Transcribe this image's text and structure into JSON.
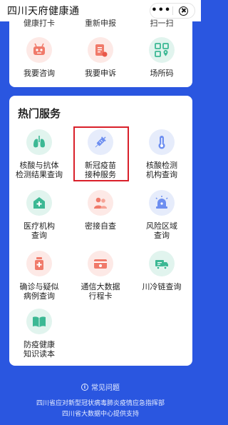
{
  "header": {
    "title": "四川天府健康通",
    "more_label": "•••"
  },
  "top_card": {
    "cut_labels": [
      "健康打卡",
      "重新申报",
      "扫一扫"
    ],
    "items": [
      {
        "label": "我要咨询",
        "icon": "robot-icon"
      },
      {
        "label": "我要申诉",
        "icon": "appeal-document-icon"
      },
      {
        "label": "场所码",
        "icon": "location-qrcode-icon"
      }
    ]
  },
  "hot_services": {
    "title": "热门服务",
    "items": [
      {
        "label": "核酸与抗体\n检测结果查询",
        "icon": "lungs-icon"
      },
      {
        "label": "新冠疫苗\n接种服务",
        "icon": "syringe-icon"
      },
      {
        "label": "核酸检测\n机构查询",
        "icon": "thermometer-icon"
      },
      {
        "label": "医疗机构\n查询",
        "icon": "hospital-icon"
      },
      {
        "label": "密接自查",
        "icon": "people-icon"
      },
      {
        "label": "风险区域\n查询",
        "icon": "alarm-light-icon"
      },
      {
        "label": "确诊与疑似\n病例查询",
        "icon": "medicine-bottle-icon"
      },
      {
        "label": "通信大数据\n行程卡",
        "icon": "itinerary-card-icon"
      },
      {
        "label": "川冷链查询",
        "icon": "cold-chain-truck-icon"
      },
      {
        "label": "防疫健康\n知识读本",
        "icon": "book-icon"
      }
    ]
  },
  "footer": {
    "faq_label": "常见问题",
    "credit_line1": "四川省应对新型冠状病毒肺炎疫情应急指挥部",
    "credit_line2": "四川省大数据中心提供支持"
  },
  "colors": {
    "background_blue": "#2a56e0",
    "icon_red": "#f07a6a",
    "icon_blue": "#6d8ef0",
    "icon_green": "#3cb894",
    "highlight_red": "#d9202a"
  }
}
